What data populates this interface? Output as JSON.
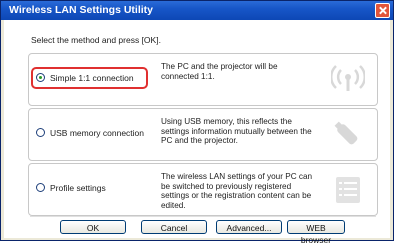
{
  "window": {
    "title": "Wireless LAN Settings Utility"
  },
  "prompt": "Select the method and press [OK].",
  "options": [
    {
      "label": "Simple 1:1 connection",
      "selected": true,
      "highlighted": true,
      "description": "The PC and the projector will be connected 1:1.",
      "icon": "wireless-signal-icon"
    },
    {
      "label": "USB memory connection",
      "selected": false,
      "highlighted": false,
      "description": "Using USB memory, this reflects the settings information mutually between the PC and the projector.",
      "icon": "usb-memory-icon"
    },
    {
      "label": "Profile settings",
      "selected": false,
      "highlighted": false,
      "description": "The wireless LAN settings of your PC can be switched to previously registered settings or the registration content can be edited.",
      "icon": "profile-list-icon"
    }
  ],
  "buttons": {
    "ok": "OK",
    "cancel": "Cancel",
    "advanced": "Advanced...",
    "web_browser": "WEB browser"
  },
  "colors": {
    "title_bar": "#1756c8",
    "highlight_border": "#e03030",
    "icon_gray": "#d8d8d8",
    "radio_dot": "#2a9a2a"
  }
}
